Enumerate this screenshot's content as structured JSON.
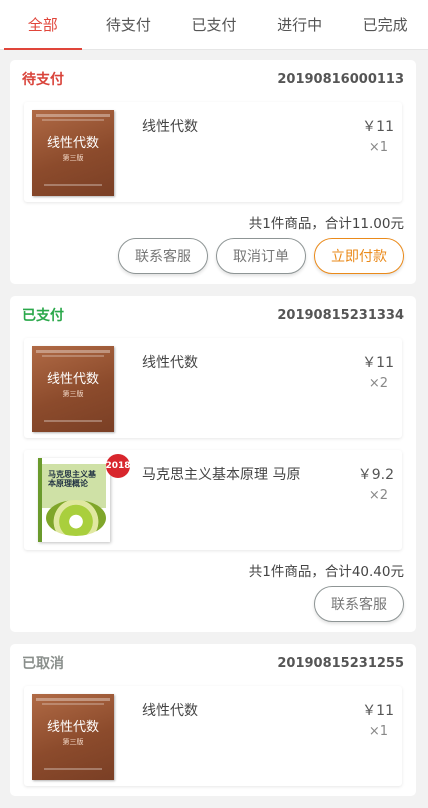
{
  "tabs": [
    "全部",
    "待支付",
    "已支付",
    "进行中",
    "已完成"
  ],
  "orders": [
    {
      "status": "待支付",
      "order_no": "20190816000113",
      "items": [
        {
          "name": "线性代数",
          "price": "￥11",
          "qty": "×1",
          "cover_title": "线性代数",
          "cover_ed": "第三版"
        }
      ],
      "summary": "共1件商品，合计11.00元",
      "buttons": [
        "联系客服",
        "取消订单",
        "立即付款"
      ]
    },
    {
      "status": "已支付",
      "order_no": "20190815231334",
      "items": [
        {
          "name": "线性代数",
          "price": "￥11",
          "qty": "×2",
          "cover_title": "线性代数",
          "cover_ed": "第三版"
        },
        {
          "name": "马克思主义基本原理 马原",
          "price": "￥9.2",
          "qty": "×2",
          "cover_title": "马克思主义基本原理概论",
          "badge": "2018"
        }
      ],
      "summary": "共1件商品，合计40.40元",
      "buttons": [
        "联系客服"
      ]
    },
    {
      "status": "已取消",
      "order_no": "20190815231255",
      "items": [
        {
          "name": "线性代数",
          "price": "￥11",
          "qty": "×1",
          "cover_title": "线性代数",
          "cover_ed": "第三版"
        }
      ]
    }
  ],
  "colors": {
    "active_tab": "#e0453a",
    "pending": "#d9433a",
    "paid": "#2aa84a",
    "cancelled": "#8a8f8c",
    "pay_button": "#ea8a1a"
  }
}
